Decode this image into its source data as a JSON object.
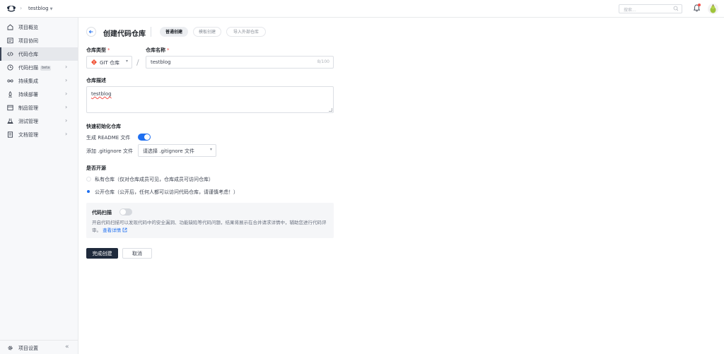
{
  "header": {
    "project_name": "testblog",
    "search_placeholder": "搜索...",
    "icons": {
      "logo": "codeup-logo-icon",
      "search": "search-icon",
      "notification": "bell-icon",
      "avatar": "avatar-pear"
    }
  },
  "sidebar": {
    "items": [
      {
        "label": "项目概览",
        "icon": "home-icon",
        "badge": "",
        "active": false,
        "has_children": false
      },
      {
        "label": "项目协同",
        "icon": "board-icon",
        "badge": "",
        "active": false,
        "has_children": false
      },
      {
        "label": "代码仓库",
        "icon": "code-icon",
        "badge": "",
        "active": true,
        "has_children": false
      },
      {
        "label": "代码扫描",
        "icon": "scan-icon",
        "badge": "beta",
        "active": false,
        "has_children": true
      },
      {
        "label": "持续集成",
        "icon": "infinity-icon",
        "badge": "",
        "active": false,
        "has_children": true
      },
      {
        "label": "持续部署",
        "icon": "rocket-icon",
        "badge": "",
        "active": false,
        "has_children": true
      },
      {
        "label": "制品管理",
        "icon": "package-icon",
        "badge": "",
        "active": false,
        "has_children": true
      },
      {
        "label": "测试管理",
        "icon": "flask-icon",
        "badge": "",
        "active": false,
        "has_children": true
      },
      {
        "label": "文档管理",
        "icon": "document-icon",
        "badge": "",
        "active": false,
        "has_children": true
      }
    ],
    "settings_label": "项目设置",
    "collapse_symbol": "«"
  },
  "page": {
    "title": "创建代码仓库",
    "tabs": [
      {
        "label": "普通创建",
        "active": true
      },
      {
        "label": "模板创建",
        "active": false
      },
      {
        "label": "导入外部仓库",
        "active": false
      }
    ]
  },
  "form": {
    "repo_type_label": "仓库类型",
    "repo_type_value": "GIT 仓库",
    "repo_name_label": "仓库名称",
    "repo_name_value": "testblog",
    "repo_name_count": "8/100",
    "required_mark": "*",
    "slash": "/",
    "desc_label": "仓库描述",
    "desc_value": "testblog",
    "init_section_label": "快速初始化仓库",
    "readme_label": "生成 README 文件",
    "readme_enabled": true,
    "gitignore_label": "添加 .gitignore 文件",
    "gitignore_placeholder": "请选择 .gitignore 文件",
    "visibility_label": "是否开源",
    "private_label": "私有仓库（仅对仓库成员可见，仓库成员可访问仓库）",
    "public_label": "公开仓库（公开后，任何人都可以访问代码仓库，请谨慎考虑！）",
    "selected_visibility": "public"
  },
  "code_scan": {
    "title": "代码扫描",
    "enabled": false,
    "description": "开启代码扫描可以发现代码中的安全漏洞、功能缺陷等代码问题，结果将展示在合并请求详情中，辅助您进行代码评审。",
    "link_text": "查看详情"
  },
  "actions": {
    "submit_label": "完成创建",
    "cancel_label": "取消"
  },
  "colors": {
    "accent": "#1f6ff0",
    "primary_button": "#1f2a3c",
    "required": "#f5504a",
    "git_brand": "#f05033"
  }
}
